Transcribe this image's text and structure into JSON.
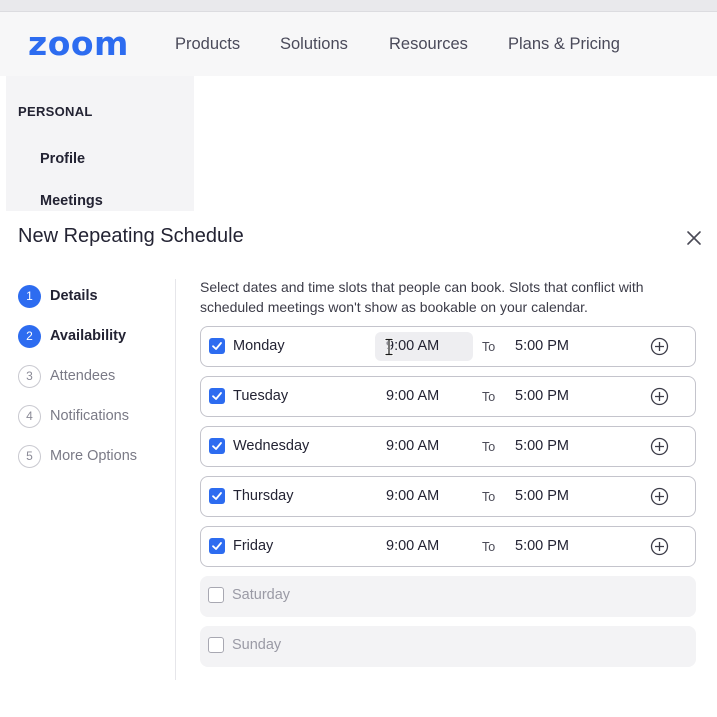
{
  "navbar": {
    "logo": "zoom",
    "items": [
      "Products",
      "Solutions",
      "Resources",
      "Plans & Pricing"
    ]
  },
  "sidebar": {
    "heading": "PERSONAL",
    "items": [
      "Profile",
      "Meetings"
    ]
  },
  "modal": {
    "title": "New Repeating Schedule",
    "steps": [
      {
        "number": "1",
        "label": "Details",
        "state": "active"
      },
      {
        "number": "2",
        "label": "Availability",
        "state": "active"
      },
      {
        "number": "3",
        "label": "Attendees",
        "state": "inactive"
      },
      {
        "number": "4",
        "label": "Notifications",
        "state": "inactive"
      },
      {
        "number": "5",
        "label": "More Options",
        "state": "inactive"
      }
    ],
    "intro": "Select dates and time slots that people can book. Slots that conflict with scheduled meetings won't show as bookable on your calendar.",
    "to_label": "To",
    "days": [
      {
        "label": "Monday",
        "checked": true,
        "start": "9:00 AM",
        "end": "5:00 PM"
      },
      {
        "label": "Tuesday",
        "checked": true,
        "start": "9:00 AM",
        "end": "5:00 PM"
      },
      {
        "label": "Wednesday",
        "checked": true,
        "start": "9:00 AM",
        "end": "5:00 PM"
      },
      {
        "label": "Thursday",
        "checked": true,
        "start": "9:00 AM",
        "end": "5:00 PM"
      },
      {
        "label": "Friday",
        "checked": true,
        "start": "9:00 AM",
        "end": "5:00 PM"
      },
      {
        "label": "Saturday",
        "checked": false
      },
      {
        "label": "Sunday",
        "checked": false
      }
    ]
  },
  "colors": {
    "accent": "#2d6cf0",
    "text": "#232333",
    "border": "#c4c4cc",
    "disabled_row": "#f3f3f5"
  },
  "icons": {
    "close": "close-icon",
    "add": "plus-circle-icon",
    "check": "checkmark-icon",
    "cursor": "text-cursor-icon"
  }
}
